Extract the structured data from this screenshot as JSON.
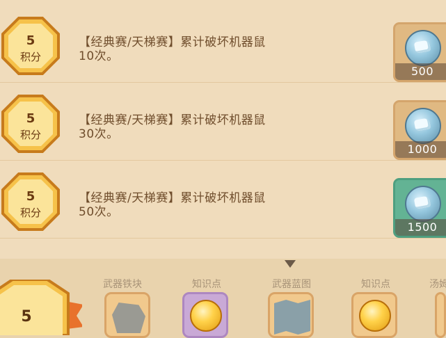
{
  "tasks": [
    {
      "points": "5",
      "unit": "积分",
      "line1": "【经典赛/天梯赛】累计破坏机器鼠",
      "line2": "10次。",
      "reward_amount": "500",
      "reward_icon": "silver-coin-icon",
      "reward_style": "tan"
    },
    {
      "points": "5",
      "unit": "积分",
      "line1": "【经典赛/天梯赛】累计破坏机器鼠",
      "line2": "30次。",
      "reward_amount": "1000",
      "reward_icon": "silver-coin-icon",
      "reward_style": "tan"
    },
    {
      "points": "5",
      "unit": "积分",
      "line1": "【经典赛/天梯赛】累计破坏机器鼠",
      "line2": "50次。",
      "reward_amount": "1500",
      "reward_icon": "silver-coin-icon",
      "reward_style": "green"
    }
  ],
  "bottom": {
    "points": "5",
    "items": [
      {
        "label": "武器铁块",
        "icon": "iron-ore-icon"
      },
      {
        "label": "知识点",
        "icon": "gold-orb-icon"
      },
      {
        "label": "武器蓝图",
        "icon": "blueprint-map-icon"
      },
      {
        "label": "知识点",
        "icon": "gold-orb-icon"
      },
      {
        "label": "汤姆",
        "icon": "unknown-item-icon"
      }
    ]
  },
  "colors": {
    "panel_bg": "#f0dcbc",
    "badge_gold": "#f6c24a",
    "text_brown": "#6f4d2c",
    "reward_green": "#63b394"
  }
}
